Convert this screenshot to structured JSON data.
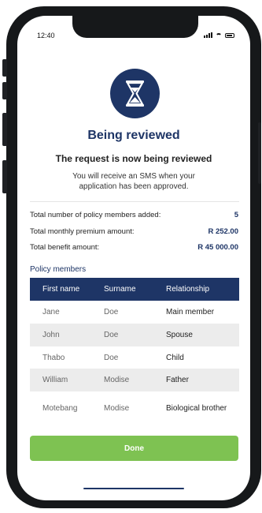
{
  "status_bar": {
    "time": "12:40"
  },
  "header": {
    "icon": "hourglass-icon",
    "title": "Being reviewed",
    "subtitle": "The request is now being reviewed",
    "description": "You will receive an SMS when your application has been approved."
  },
  "summary": [
    {
      "label": "Total number of policy members added:",
      "value": "5"
    },
    {
      "label": "Total monthly premium amount:",
      "value": "R 252.00"
    },
    {
      "label": "Total benefit amount:",
      "value": "R 45 000.00"
    }
  ],
  "policy_members": {
    "label": "Policy members",
    "columns": [
      "First name",
      "Surname",
      "Relationship"
    ],
    "rows": [
      {
        "first": "Jane",
        "surname": "Doe",
        "relationship": "Main member"
      },
      {
        "first": "John",
        "surname": "Doe",
        "relationship": "Spouse"
      },
      {
        "first": "Thabo",
        "surname": "Doe",
        "relationship": "Child"
      },
      {
        "first": "William",
        "surname": "Modise",
        "relationship": "Father"
      },
      {
        "first": "Motebang",
        "surname": "Modise",
        "relationship": "Biological brother"
      }
    ]
  },
  "actions": {
    "done_label": "Done"
  },
  "colors": {
    "navy": "#1e3566",
    "green": "#7ec252",
    "row_alt": "#ececec"
  }
}
